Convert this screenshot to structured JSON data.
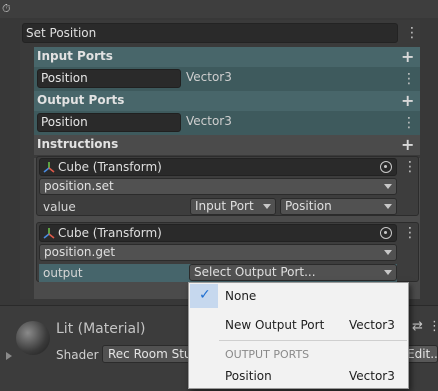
{
  "window": {
    "title_field": "Set Position"
  },
  "input_ports": {
    "header": "Input Ports",
    "ports": [
      {
        "name": "Position",
        "type": "Vector3"
      }
    ]
  },
  "output_ports": {
    "header": "Output Ports",
    "ports": [
      {
        "name": "Position",
        "type": "Vector3"
      }
    ]
  },
  "instructions": {
    "header": "Instructions",
    "items": [
      {
        "object": "Cube (Transform)",
        "method": "position.set",
        "param_label": "value",
        "source_dropdown": "Input Port",
        "port_dropdown": "Position"
      },
      {
        "object": "Cube (Transform)",
        "method": "position.get",
        "param_label": "output",
        "port_dropdown": "Select Output Port..."
      }
    ]
  },
  "material": {
    "title": "Lit (Material)",
    "shader_label": "Shader",
    "shader_value": "Rec Room Stu",
    "edit_button": "Edit..."
  },
  "dropdown_menu": {
    "items": [
      {
        "label": "None",
        "checked": true
      },
      {
        "label": "New Output Port",
        "type": "Vector3"
      }
    ],
    "section_header": "OUTPUT PORTS",
    "ports": [
      {
        "label": "Position",
        "type": "Vector3"
      }
    ]
  },
  "icons": {
    "top_left": "stopwatch-icon",
    "kebab": "kebab-menu-icon",
    "add": "plus-icon",
    "transform": "transform-icon",
    "object_picker": "object-picker-icon",
    "check": "checkmark-icon"
  },
  "colors": {
    "teal_header": "#48666a",
    "menu_check": "#1f6fd1",
    "menu_bg": "#f2f2f2"
  }
}
